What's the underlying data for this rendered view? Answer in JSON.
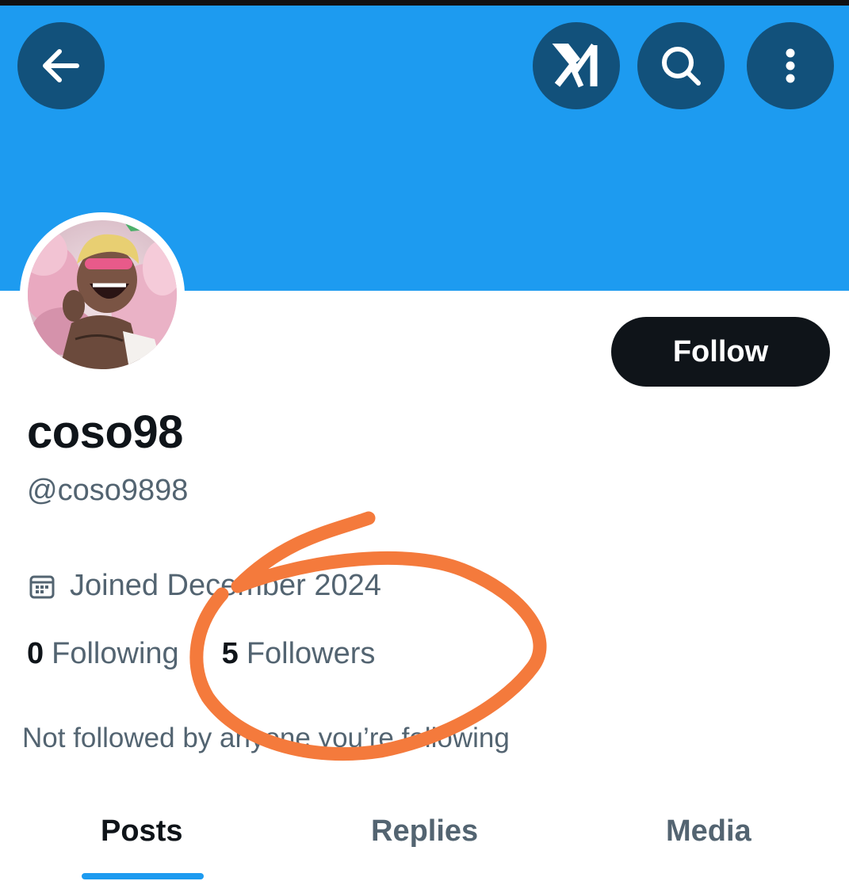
{
  "header": {
    "back_icon": "arrow-left-icon",
    "grok_icon": "grok-icon",
    "search_icon": "search-icon",
    "more_icon": "more-vertical-icon",
    "banner_color": "#1d9bf0",
    "button_color": "#12517b"
  },
  "profile": {
    "display_name": "coso98",
    "handle": "@coso9898",
    "follow_label": "Follow",
    "joined_icon": "calendar-icon",
    "joined_text": "Joined December 2024",
    "following_count": "0",
    "following_label": "Following",
    "followers_count": "5",
    "followers_label": "Followers",
    "not_followed_text": "Not followed by anyone you’re following"
  },
  "tabs": [
    {
      "label": "Posts",
      "active": true
    },
    {
      "label": "Replies",
      "active": false
    },
    {
      "label": "Media",
      "active": false
    }
  ],
  "colors": {
    "accent": "#1d9bf0",
    "text_primary": "#0f1419",
    "text_secondary": "#536471",
    "annotation": "#f47a3c"
  }
}
